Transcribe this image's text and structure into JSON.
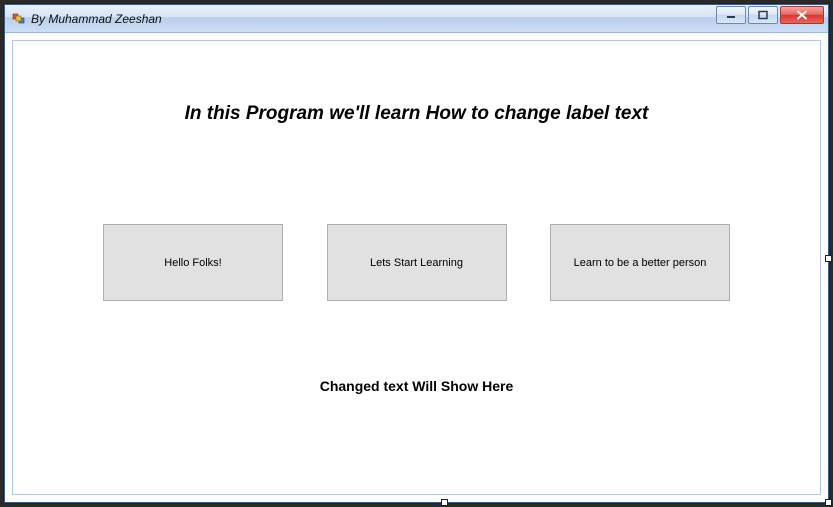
{
  "window": {
    "title": "By Muhammad Zeeshan"
  },
  "heading": "In this Program we'll learn How to change label text",
  "buttons": {
    "b1": "Hello Folks!",
    "b2": "Lets Start Learning",
    "b3": "Learn to be a better person"
  },
  "result_label": "Changed text Will Show Here"
}
